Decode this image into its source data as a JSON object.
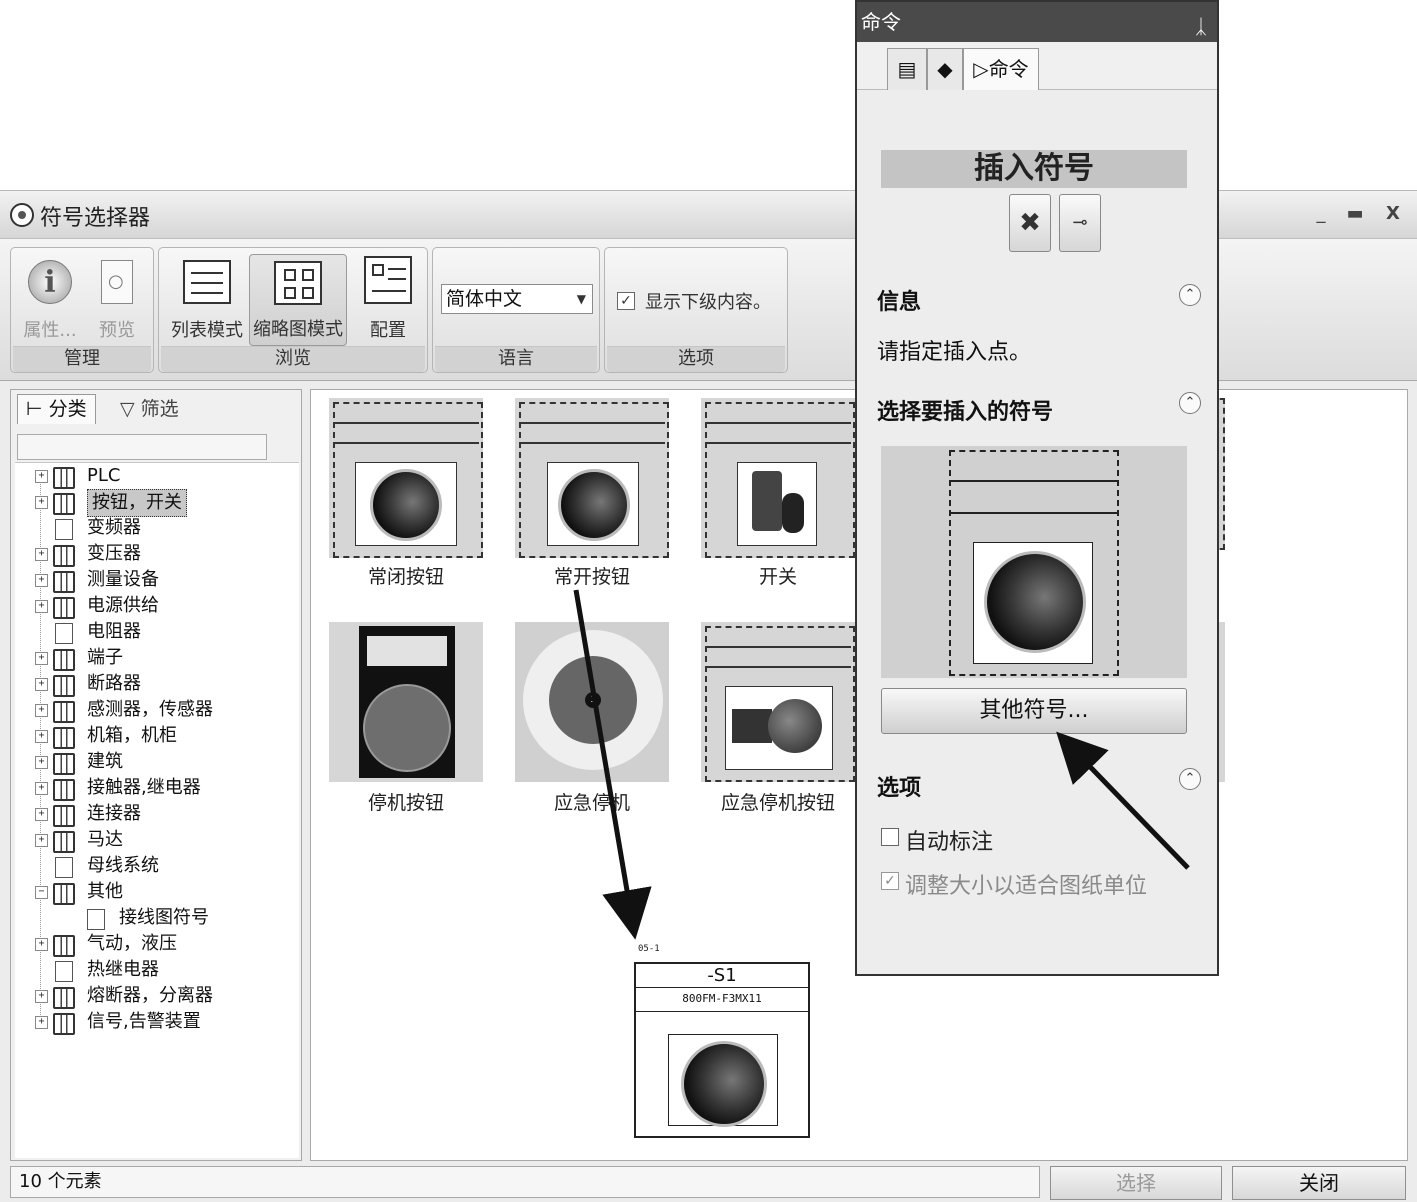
{
  "window": {
    "title": "符号选择器",
    "controls": [
      "_",
      "▬",
      "X"
    ]
  },
  "ribbon": {
    "groups": {
      "manage": "管理",
      "browse": "浏览",
      "language": "语言",
      "options": "选项"
    },
    "buttons": {
      "properties": "属性...",
      "preview": "预览",
      "list_mode": "列表模式",
      "thumb_mode": "缩略图模式",
      "config": "配置"
    },
    "language_value": "简体中文",
    "show_sub_checked": "✓",
    "show_sub_label": "显示下级内容。"
  },
  "left_panel": {
    "tab_category": "分类",
    "tab_filter": "筛选",
    "tree": [
      {
        "label": "PLC",
        "type": "book"
      },
      {
        "label": "按钮，开关",
        "type": "book",
        "selected": true
      },
      {
        "label": "变频器",
        "type": "page"
      },
      {
        "label": "变压器",
        "type": "book"
      },
      {
        "label": "测量设备",
        "type": "book"
      },
      {
        "label": "电源供给",
        "type": "book"
      },
      {
        "label": "电阻器",
        "type": "page"
      },
      {
        "label": "端子",
        "type": "book"
      },
      {
        "label": "断路器",
        "type": "book"
      },
      {
        "label": "感测器，传感器",
        "type": "book"
      },
      {
        "label": "机箱，机柜",
        "type": "book"
      },
      {
        "label": "建筑",
        "type": "book"
      },
      {
        "label": "接触器,继电器",
        "type": "book"
      },
      {
        "label": "连接器",
        "type": "book"
      },
      {
        "label": "马达",
        "type": "book"
      },
      {
        "label": "母线系统",
        "type": "page"
      },
      {
        "label": "其他",
        "type": "book",
        "expanded": true
      },
      {
        "label": "接线图符号",
        "type": "page",
        "child": true
      },
      {
        "label": "气动，液压",
        "type": "book"
      },
      {
        "label": "热继电器",
        "type": "page"
      },
      {
        "label": "熔断器，分离器",
        "type": "book"
      },
      {
        "label": "信号,告警装置",
        "type": "book"
      }
    ]
  },
  "thumbnails": [
    {
      "label": "常闭按钮"
    },
    {
      "label": "常开按钮"
    },
    {
      "label": "开关"
    },
    {
      "label": "停机按钮"
    },
    {
      "label": "应急停机"
    },
    {
      "label": "应急停机按钮"
    }
  ],
  "placed_symbol": {
    "ref": "05-1",
    "tag": "-S1",
    "part": "800FM-F3MX11"
  },
  "status": {
    "count": "10 个元素",
    "select_button": "选择",
    "close_button": "关闭"
  },
  "command_panel": {
    "title": "命令",
    "tab_command": "命令",
    "insert_title": "插入符号",
    "info_title": "信息",
    "info_text": "请指定插入点。",
    "select_title": "选择要插入的符号",
    "other_button": "其他符号...",
    "options_title": "选项",
    "opt_auto_label": "自动标注",
    "opt_resize_label": "调整大小以适合图纸单位",
    "opt_resize_checked": "✓"
  }
}
